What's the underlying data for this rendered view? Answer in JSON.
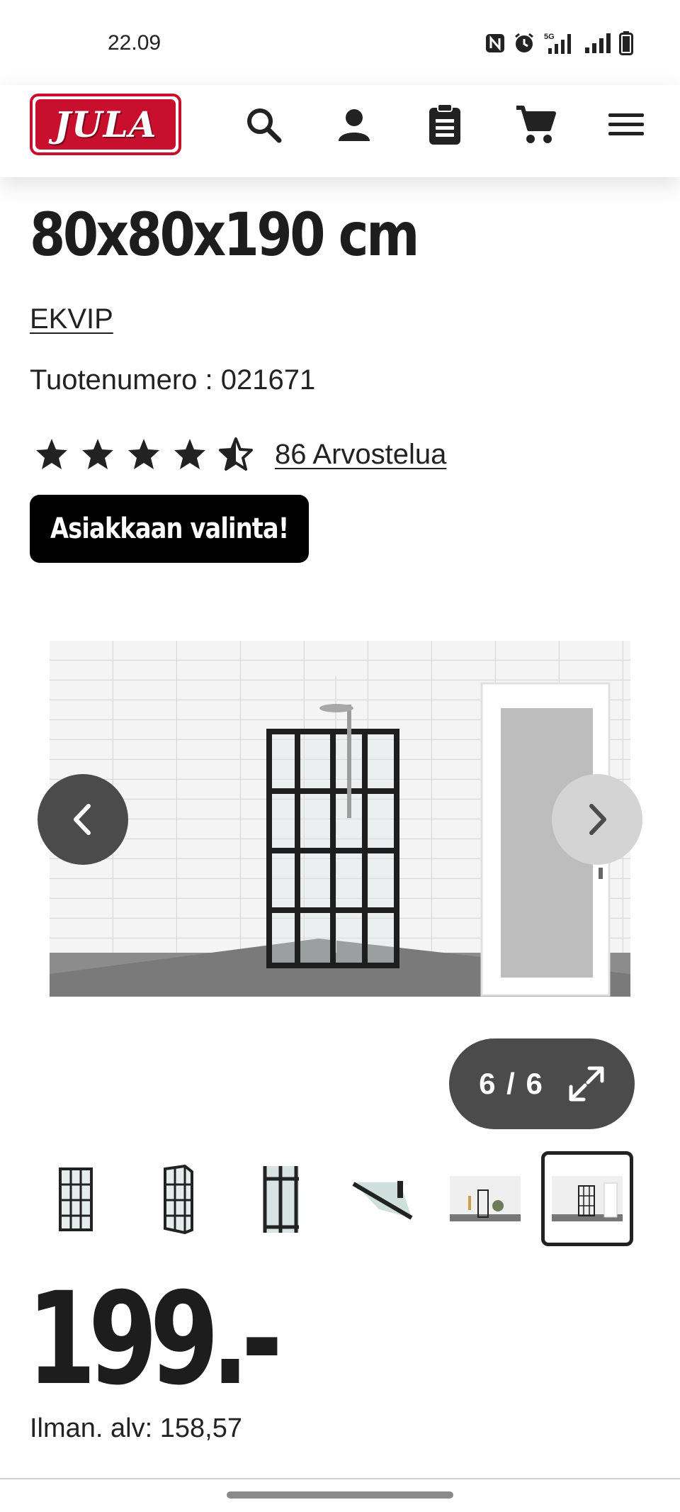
{
  "status_bar": {
    "time": "22.09",
    "network": "5G"
  },
  "header": {
    "logo_text": "JULA",
    "icons": [
      "search-icon",
      "account-icon",
      "shopping-list-icon",
      "cart-icon",
      "menu-icon"
    ]
  },
  "product": {
    "title": "80x80x190 cm",
    "brand": "EKVIP",
    "product_number_label": "Tuotenumero :",
    "product_number": "021671",
    "rating": 4.5,
    "reviews_label": "86 Arvostelua",
    "badge": "Asiakkaan valinta!"
  },
  "gallery": {
    "counter": "6 / 6",
    "current": 6,
    "total": 6,
    "thumbnails": [
      "thumb-1",
      "thumb-2",
      "thumb-3",
      "thumb-4",
      "thumb-5",
      "thumb-6"
    ]
  },
  "price": {
    "amount": "199.-",
    "vat_label": "Ilman. alv: 158,57"
  },
  "colors": {
    "brand_red": "#c8102e",
    "dark": "#1d1d1d",
    "button_grey": "#4b4b4b",
    "button_light": "#d4d4d4"
  }
}
